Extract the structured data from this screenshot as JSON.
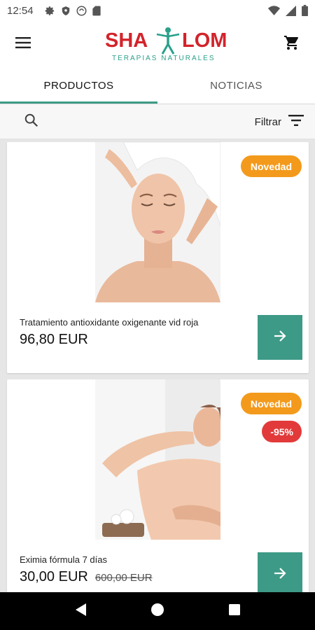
{
  "status_bar": {
    "time": "12:54",
    "left_icons": [
      "settings-icon",
      "shield-icon",
      "vpn-icon",
      "sd-card-icon"
    ],
    "right_icons": [
      "wifi-icon",
      "signal-icon",
      "battery-icon"
    ]
  },
  "app_bar": {
    "logo_left": "SHA",
    "logo_right": "LOM",
    "logo_tagline": "TERAPIAS NATURALES",
    "menu_icon": "hamburger-menu-icon",
    "cart_icon": "shopping-cart-icon"
  },
  "tabs": [
    {
      "label": "PRODUCTOS",
      "active": true
    },
    {
      "label": "NOTICIAS",
      "active": false
    }
  ],
  "filter_bar": {
    "search_icon": "search-icon",
    "filter_label": "Filtrar",
    "filter_icon": "filter-list-icon"
  },
  "products": [
    {
      "name": "Tratamiento antioxidante oxigenante vid roja",
      "price": "96,80 EUR",
      "old_price": "",
      "badges": [
        "Novedad"
      ],
      "image": "woman-facial-massage-photo"
    },
    {
      "name": "Eximia fórmula 7 días",
      "price": "30,00 EUR",
      "old_price": "600,00 EUR",
      "badges": [
        "Novedad",
        "-95%"
      ],
      "image": "woman-back-massage-photo"
    }
  ],
  "nav_bar": {
    "back_icon": "back-triangle-icon",
    "home_icon": "home-circle-icon",
    "recents_icon": "recents-square-icon"
  },
  "colors": {
    "brand_red": "#d3232b",
    "brand_teal": "#3d9a86",
    "badge_orange": "#f39a1c",
    "badge_red": "#e23a3a"
  }
}
